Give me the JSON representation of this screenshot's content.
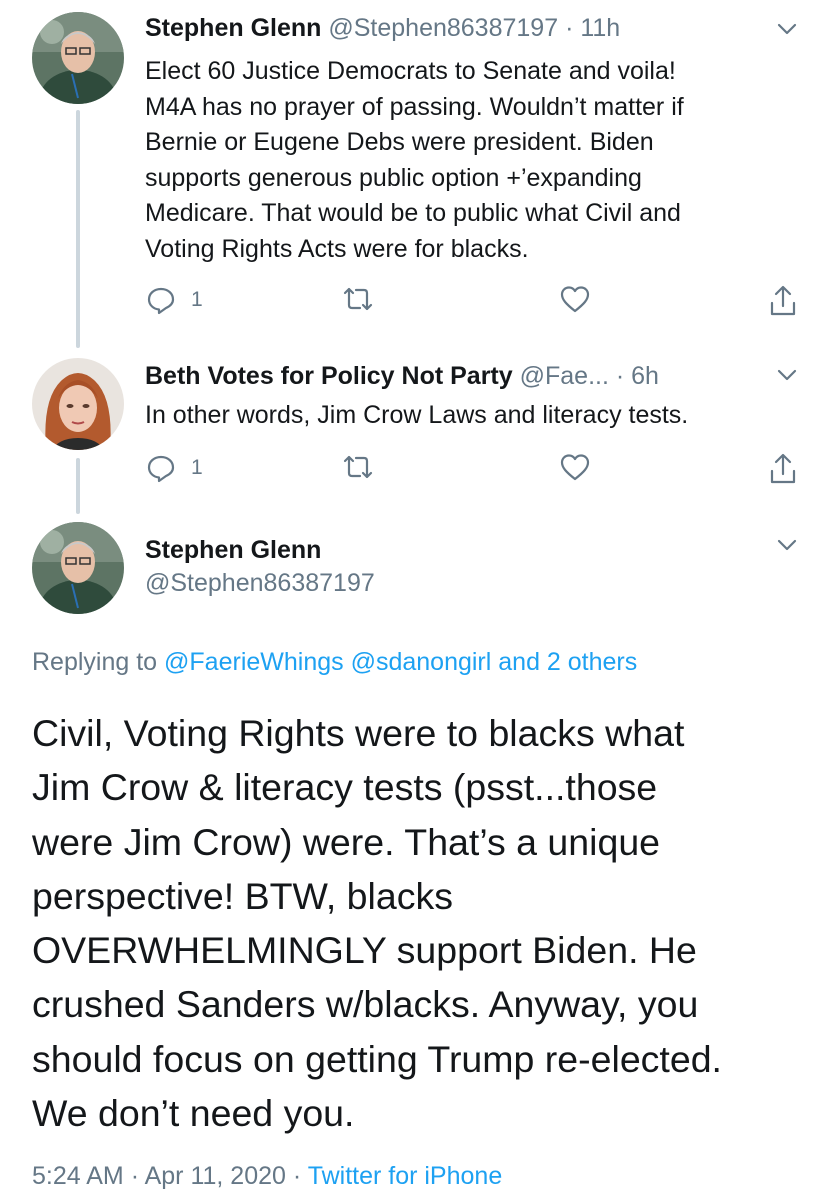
{
  "tweets": [
    {
      "name": "Stephen Glenn",
      "handle": "@Stephen86387197",
      "sep": "·",
      "time": "11h",
      "lines": [
        "Elect 60 Justice Democrats to Senate and voila!",
        "M4A has no prayer of passing. Wouldn’t matter if",
        "Bernie or Eugene Debs were president. Biden",
        "supports generous public option +’expanding",
        "Medicare. That would be to public what Civil and",
        "Voting Rights Acts were for blacks."
      ],
      "reply_count": "1"
    },
    {
      "name": "Beth Votes for Policy Not Party",
      "handle": "@Fae...",
      "sep": "·",
      "time": "6h",
      "lines": [
        "In other words, Jim Crow Laws and literacy tests."
      ],
      "reply_count": "1"
    }
  ],
  "main_tweet": {
    "name": "Stephen Glenn",
    "handle": "@Stephen86387197",
    "replying_prefix": "Replying to",
    "replying_to": "@FaerieWhings @sdanongirl and 2 others",
    "lines": [
      "Civil, Voting Rights were to blacks what",
      "Jim Crow & literacy tests (psst...those",
      "were Jim Crow) were. That’s a unique",
      "perspective! BTW, blacks",
      "OVERWHELMINGLY support Biden. He",
      "crushed Sanders w/blacks. Anyway, you",
      "should focus on getting Trump re-elected.",
      "We don’t need you."
    ],
    "time": "5:24 AM",
    "sep1": "·",
    "date": "Apr 11, 2020",
    "sep2": "·",
    "source": "Twitter for iPhone"
  },
  "icons": {
    "reply": "reply-icon",
    "retweet": "retweet-icon",
    "like": "like-icon",
    "share": "share-icon",
    "caret": "chevron-down-icon"
  },
  "colors": {
    "text": "#14171a",
    "secondary": "#657786",
    "link": "#1da1f2",
    "thread_line": "#ccd6dd"
  }
}
